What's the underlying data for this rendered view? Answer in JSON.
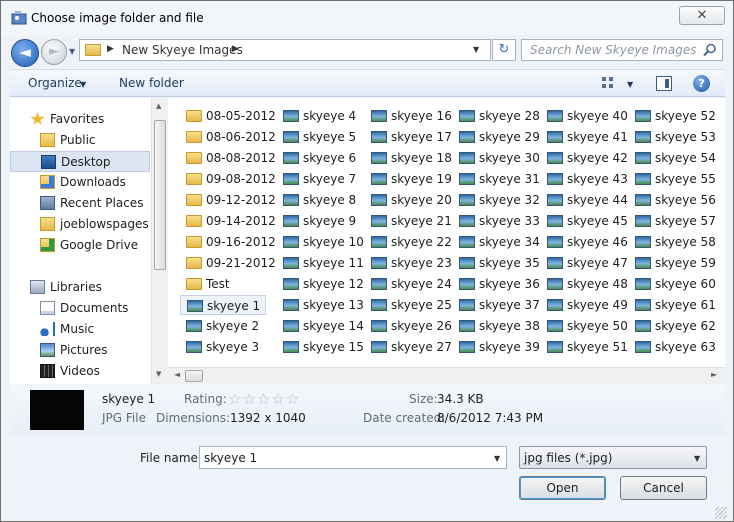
{
  "window": {
    "title": "Choose image folder and file",
    "close_glyph": "✕"
  },
  "nav": {
    "back_glyph": "◄",
    "forward_glyph": "►",
    "dropdown_glyph": "▼"
  },
  "address": {
    "path": "New Skyeye Images",
    "sep": "▶",
    "dropdown_glyph": "▼"
  },
  "refresh_glyph": "↻",
  "search": {
    "placeholder": "Search New Skyeye Images"
  },
  "toolbar": {
    "organize": "Organize",
    "arrow": "▼",
    "new_folder": "New folder",
    "help": "?"
  },
  "sidebar": {
    "items": [
      {
        "label": "Favorites",
        "icon": "star-icon",
        "head": true
      },
      {
        "label": "Public",
        "icon": "folder-icon"
      },
      {
        "label": "Desktop",
        "icon": "desktop-icon",
        "selected": true
      },
      {
        "label": "Downloads",
        "icon": "downloads-icon"
      },
      {
        "label": "Recent Places",
        "icon": "recent-places-icon"
      },
      {
        "label": "joeblowspages o",
        "icon": "folder-icon"
      },
      {
        "label": "Google Drive",
        "icon": "google-drive-icon"
      },
      {
        "label": "Libraries",
        "icon": "libraries-icon",
        "head": true
      },
      {
        "label": "Documents",
        "icon": "documents-icon"
      },
      {
        "label": "Music",
        "icon": "music-icon"
      },
      {
        "label": "Pictures",
        "icon": "pictures-icon"
      },
      {
        "label": "Videos",
        "icon": "videos-icon"
      }
    ]
  },
  "files": [
    {
      "name": "08-05-2012",
      "type": "folder"
    },
    {
      "name": "08-06-2012",
      "type": "folder"
    },
    {
      "name": "08-08-2012",
      "type": "folder"
    },
    {
      "name": "09-08-2012",
      "type": "folder"
    },
    {
      "name": "09-12-2012",
      "type": "folder"
    },
    {
      "name": "09-14-2012",
      "type": "folder"
    },
    {
      "name": "09-16-2012",
      "type": "folder"
    },
    {
      "name": "09-21-2012",
      "type": "folder"
    },
    {
      "name": "Test",
      "type": "folder"
    },
    {
      "name": "skyeye 1",
      "type": "image",
      "selected": true
    },
    {
      "name": "skyeye 2",
      "type": "image"
    },
    {
      "name": "skyeye 3",
      "type": "image"
    },
    {
      "name": "skyeye 4",
      "type": "image"
    },
    {
      "name": "skyeye 5",
      "type": "image"
    },
    {
      "name": "skyeye 6",
      "type": "image"
    },
    {
      "name": "skyeye 7",
      "type": "image"
    },
    {
      "name": "skyeye 8",
      "type": "image"
    },
    {
      "name": "skyeye 9",
      "type": "image"
    },
    {
      "name": "skyeye 10",
      "type": "image"
    },
    {
      "name": "skyeye 11",
      "type": "image"
    },
    {
      "name": "skyeye 12",
      "type": "image"
    },
    {
      "name": "skyeye 13",
      "type": "image"
    },
    {
      "name": "skyeye 14",
      "type": "image"
    },
    {
      "name": "skyeye 15",
      "type": "image"
    },
    {
      "name": "skyeye 16",
      "type": "image"
    },
    {
      "name": "skyeye 17",
      "type": "image"
    },
    {
      "name": "skyeye 18",
      "type": "image"
    },
    {
      "name": "skyeye 19",
      "type": "image"
    },
    {
      "name": "skyeye 20",
      "type": "image"
    },
    {
      "name": "skyeye 21",
      "type": "image"
    },
    {
      "name": "skyeye 22",
      "type": "image"
    },
    {
      "name": "skyeye 23",
      "type": "image"
    },
    {
      "name": "skyeye 24",
      "type": "image"
    },
    {
      "name": "skyeye 25",
      "type": "image"
    },
    {
      "name": "skyeye 26",
      "type": "image"
    },
    {
      "name": "skyeye 27",
      "type": "image"
    },
    {
      "name": "skyeye 28",
      "type": "image"
    },
    {
      "name": "skyeye 29",
      "type": "image"
    },
    {
      "name": "skyeye 30",
      "type": "image"
    },
    {
      "name": "skyeye 31",
      "type": "image"
    },
    {
      "name": "skyeye 32",
      "type": "image"
    },
    {
      "name": "skyeye 33",
      "type": "image"
    },
    {
      "name": "skyeye 34",
      "type": "image"
    },
    {
      "name": "skyeye 35",
      "type": "image"
    },
    {
      "name": "skyeye 36",
      "type": "image"
    },
    {
      "name": "skyeye 37",
      "type": "image"
    },
    {
      "name": "skyeye 38",
      "type": "image"
    },
    {
      "name": "skyeye 39",
      "type": "image"
    },
    {
      "name": "skyeye 40",
      "type": "image"
    },
    {
      "name": "skyeye 41",
      "type": "image"
    },
    {
      "name": "skyeye 42",
      "type": "image"
    },
    {
      "name": "skyeye 43",
      "type": "image"
    },
    {
      "name": "skyeye 44",
      "type": "image"
    },
    {
      "name": "skyeye 45",
      "type": "image"
    },
    {
      "name": "skyeye 46",
      "type": "image"
    },
    {
      "name": "skyeye 47",
      "type": "image"
    },
    {
      "name": "skyeye 48",
      "type": "image"
    },
    {
      "name": "skyeye 49",
      "type": "image"
    },
    {
      "name": "skyeye 50",
      "type": "image"
    },
    {
      "name": "skyeye 51",
      "type": "image"
    },
    {
      "name": "skyeye 52",
      "type": "image"
    },
    {
      "name": "skyeye 53",
      "type": "image"
    },
    {
      "name": "skyeye 54",
      "type": "image"
    },
    {
      "name": "skyeye 55",
      "type": "image"
    },
    {
      "name": "skyeye 56",
      "type": "image"
    },
    {
      "name": "skyeye 57",
      "type": "image"
    },
    {
      "name": "skyeye 58",
      "type": "image"
    },
    {
      "name": "skyeye 59",
      "type": "image"
    },
    {
      "name": "skyeye 60",
      "type": "image"
    },
    {
      "name": "skyeye 61",
      "type": "image"
    },
    {
      "name": "skyeye 62",
      "type": "image"
    },
    {
      "name": "skyeye 63",
      "type": "image"
    }
  ],
  "details": {
    "name": "skyeye 1",
    "type": "JPG File",
    "rating_label": "Rating:",
    "rating_value": 0,
    "stars": "☆☆☆☆☆",
    "dimensions_label": "Dimensions:",
    "dimensions": "1392 x 1040",
    "size_label": "Size:",
    "size": "34.3 KB",
    "date_label": "Date created:",
    "date": "8/6/2012 7:43 PM"
  },
  "footer": {
    "filename_label": "File name:",
    "filename_value": "skyeye 1",
    "filetype": "jpg files (*.jpg)",
    "open": "Open",
    "cancel": "Cancel",
    "arrow": "▼"
  },
  "scroll": {
    "up": "▲",
    "down": "▼",
    "left": "◄",
    "right": "►"
  }
}
